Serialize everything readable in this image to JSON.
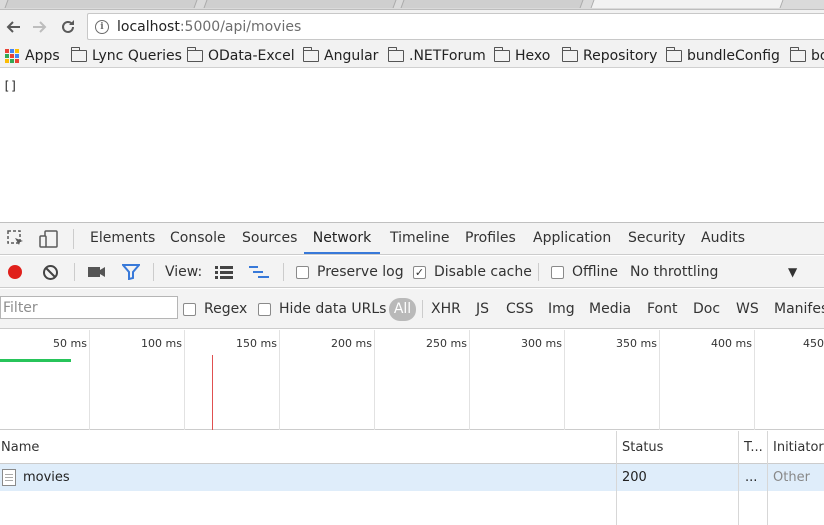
{
  "browser": {
    "address": {
      "host": "localhost",
      "path": ":5000/api/movies"
    },
    "bookmarks": [
      {
        "label": "Apps",
        "icon": "apps-icon"
      },
      {
        "label": "Lync Queries",
        "icon": "folder-icon"
      },
      {
        "label": "OData-Excel",
        "icon": "folder-icon"
      },
      {
        "label": "Angular",
        "icon": "folder-icon"
      },
      {
        "label": ".NETForum",
        "icon": "folder-icon"
      },
      {
        "label": "Hexo",
        "icon": "folder-icon"
      },
      {
        "label": "Repository",
        "icon": "folder-icon"
      },
      {
        "label": "bundleConfig",
        "icon": "folder-icon"
      },
      {
        "label": "bo",
        "icon": "folder-icon"
      }
    ]
  },
  "page": {
    "response_body": "[]"
  },
  "devtools": {
    "tabs": [
      "Elements",
      "Console",
      "Sources",
      "Network",
      "Timeline",
      "Profiles",
      "Application",
      "Security",
      "Audits"
    ],
    "active_tab": "Network",
    "toolbar": {
      "view_label": "View:",
      "preserve_log": "Preserve log",
      "preserve_log_checked": false,
      "disable_cache": "Disable cache",
      "disable_cache_checked": true,
      "offline": "Offline",
      "offline_checked": false,
      "throttling": "No throttling"
    },
    "filterbar": {
      "filter_placeholder": "Filter",
      "regex": "Regex",
      "hide_data_urls": "Hide data URLs",
      "all": "All",
      "types": [
        "XHR",
        "JS",
        "CSS",
        "Img",
        "Media",
        "Font",
        "Doc",
        "WS",
        "Manifes"
      ]
    },
    "overview": {
      "ticks": [
        "50 ms",
        "100 ms",
        "150 ms",
        "200 ms",
        "250 ms",
        "300 ms",
        "350 ms",
        "400 ms",
        "450"
      ]
    },
    "table": {
      "headers": {
        "name": "Name",
        "status": "Status",
        "type": "T...",
        "initiator": "Initiator"
      },
      "rows": [
        {
          "name": "movies",
          "status": "200",
          "type": "...",
          "initiator": "Other"
        }
      ]
    },
    "colors": {
      "accent": "#3879d9",
      "record": "#e0201b",
      "filter": "#3879d9",
      "selected_row": "#dfedfa"
    }
  }
}
